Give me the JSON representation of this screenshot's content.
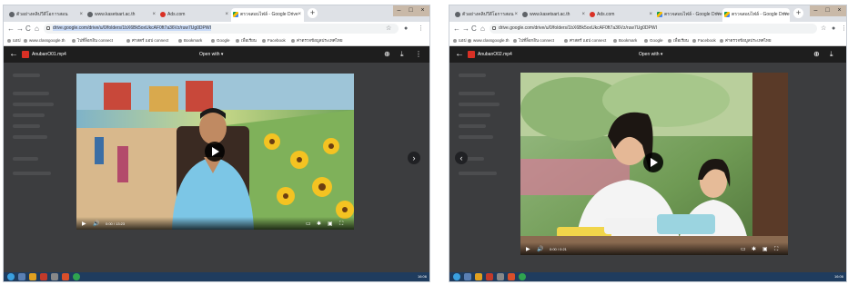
{
  "left": {
    "tabs": [
      {
        "title": "ตัวอย่างคลิปวีดีโอการสอน",
        "icon": "globe-icon",
        "active": false
      },
      {
        "title": "www.kasetsart.ac.th",
        "icon": "globe-icon",
        "active": false
      },
      {
        "title": "Ads.com",
        "icon": "red-circle-icon",
        "active": false
      },
      {
        "title": "ตรวจสอบไฟล์ - Google Drive",
        "icon": "drive-icon",
        "active": true
      }
    ],
    "url": "drive.google.com/drive/u/0/folders/1bX6Bk5oxUkcAF0ft7a36Vz/ruw7Ug0DPWI",
    "bookmarks": [
      "แอป",
      "www.classgoogle.th",
      "ไปที่ล็อกอิน connect",
      "ศาสตร์ แอป connect",
      "Bookmark",
      "Google",
      "เพื่อเรียน",
      "Facebook",
      "ค่าตรวจข้อมูลประเทศไทย"
    ],
    "file_name": "AnubanO01.mp4",
    "open_with": "Open with",
    "time": "0:00 / 13:23",
    "tray_clock": "16:06"
  },
  "right": {
    "tabs": [
      {
        "title": "ตัวอย่างคลิปวีดีโอการสอน",
        "icon": "globe-icon",
        "active": false
      },
      {
        "title": "www.kasetsart.ac.th",
        "icon": "globe-icon",
        "active": false
      },
      {
        "title": "Ads.com",
        "icon": "red-circle-icon",
        "active": false
      },
      {
        "title": "ตรวจสอบไฟล์ - Google Drive",
        "icon": "drive-icon",
        "active": false
      },
      {
        "title": "ตรวจสอบไฟล์ - Google Drive",
        "icon": "drive-icon",
        "active": true
      }
    ],
    "url": "drive.google.com/drive/u/0/folders/1bX6Bk5oxUkcAF0ft7a36Vz/ruw7Ug0DPWI",
    "bookmarks": [
      "แอป",
      "www.classgoogle.th",
      "ไปที่ล็อกอิน connect",
      "ศาสตร์ แอป connect",
      "Bookmark",
      "Google",
      "เพื่อเรียน",
      "Facebook",
      "ค่าตรวจข้อมูลประเทศไทย"
    ],
    "file_name": "AnubanO02.mp4",
    "open_with": "Open with",
    "time": "0:00 / 0:21",
    "tray_clock": "16:06"
  },
  "colors": {
    "viewer_bg": "#3c3d3f",
    "taskbar": "#1f3c5e",
    "tab_strip": "#dee1e6"
  }
}
